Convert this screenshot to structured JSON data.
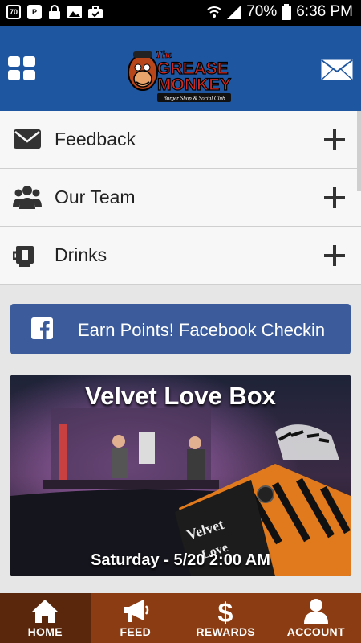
{
  "status_bar": {
    "left_icons": [
      "notification-icon",
      "parking-icon",
      "lock-icon",
      "image-icon",
      "briefcase-icon"
    ],
    "left_icon_text": [
      "70",
      "P",
      "",
      "",
      ""
    ],
    "battery": "70%",
    "time": "6:36 PM"
  },
  "header": {
    "logo_line1": "The",
    "logo_line2": "GREASE",
    "logo_line3": "MONKEY",
    "logo_tagline": "Burger Shop & Social Club",
    "brand_color": "#1f56a0"
  },
  "menu": {
    "items": [
      {
        "label": "Feedback",
        "icon": "envelope-icon"
      },
      {
        "label": "Our Team",
        "icon": "group-icon"
      },
      {
        "label": "Drinks",
        "icon": "mug-icon"
      }
    ]
  },
  "checkin": {
    "label": "Earn Points! Facebook Checkin",
    "color": "#3b5b9a"
  },
  "event": {
    "title": "Velvet Love Box",
    "date": "Saturday - 5/20 2:00 AM",
    "sign_text": "Velvet Love Box"
  },
  "tabbar": {
    "tabs": [
      {
        "label": "HOME",
        "icon": "home-icon",
        "active": true
      },
      {
        "label": "FEED",
        "icon": "megaphone-icon",
        "active": false
      },
      {
        "label": "REWARDS",
        "icon": "dollar-icon",
        "active": false
      },
      {
        "label": "ACCOUNT",
        "icon": "user-icon",
        "active": false
      }
    ],
    "color": "#8b3c12",
    "active_color": "#5a270c"
  }
}
